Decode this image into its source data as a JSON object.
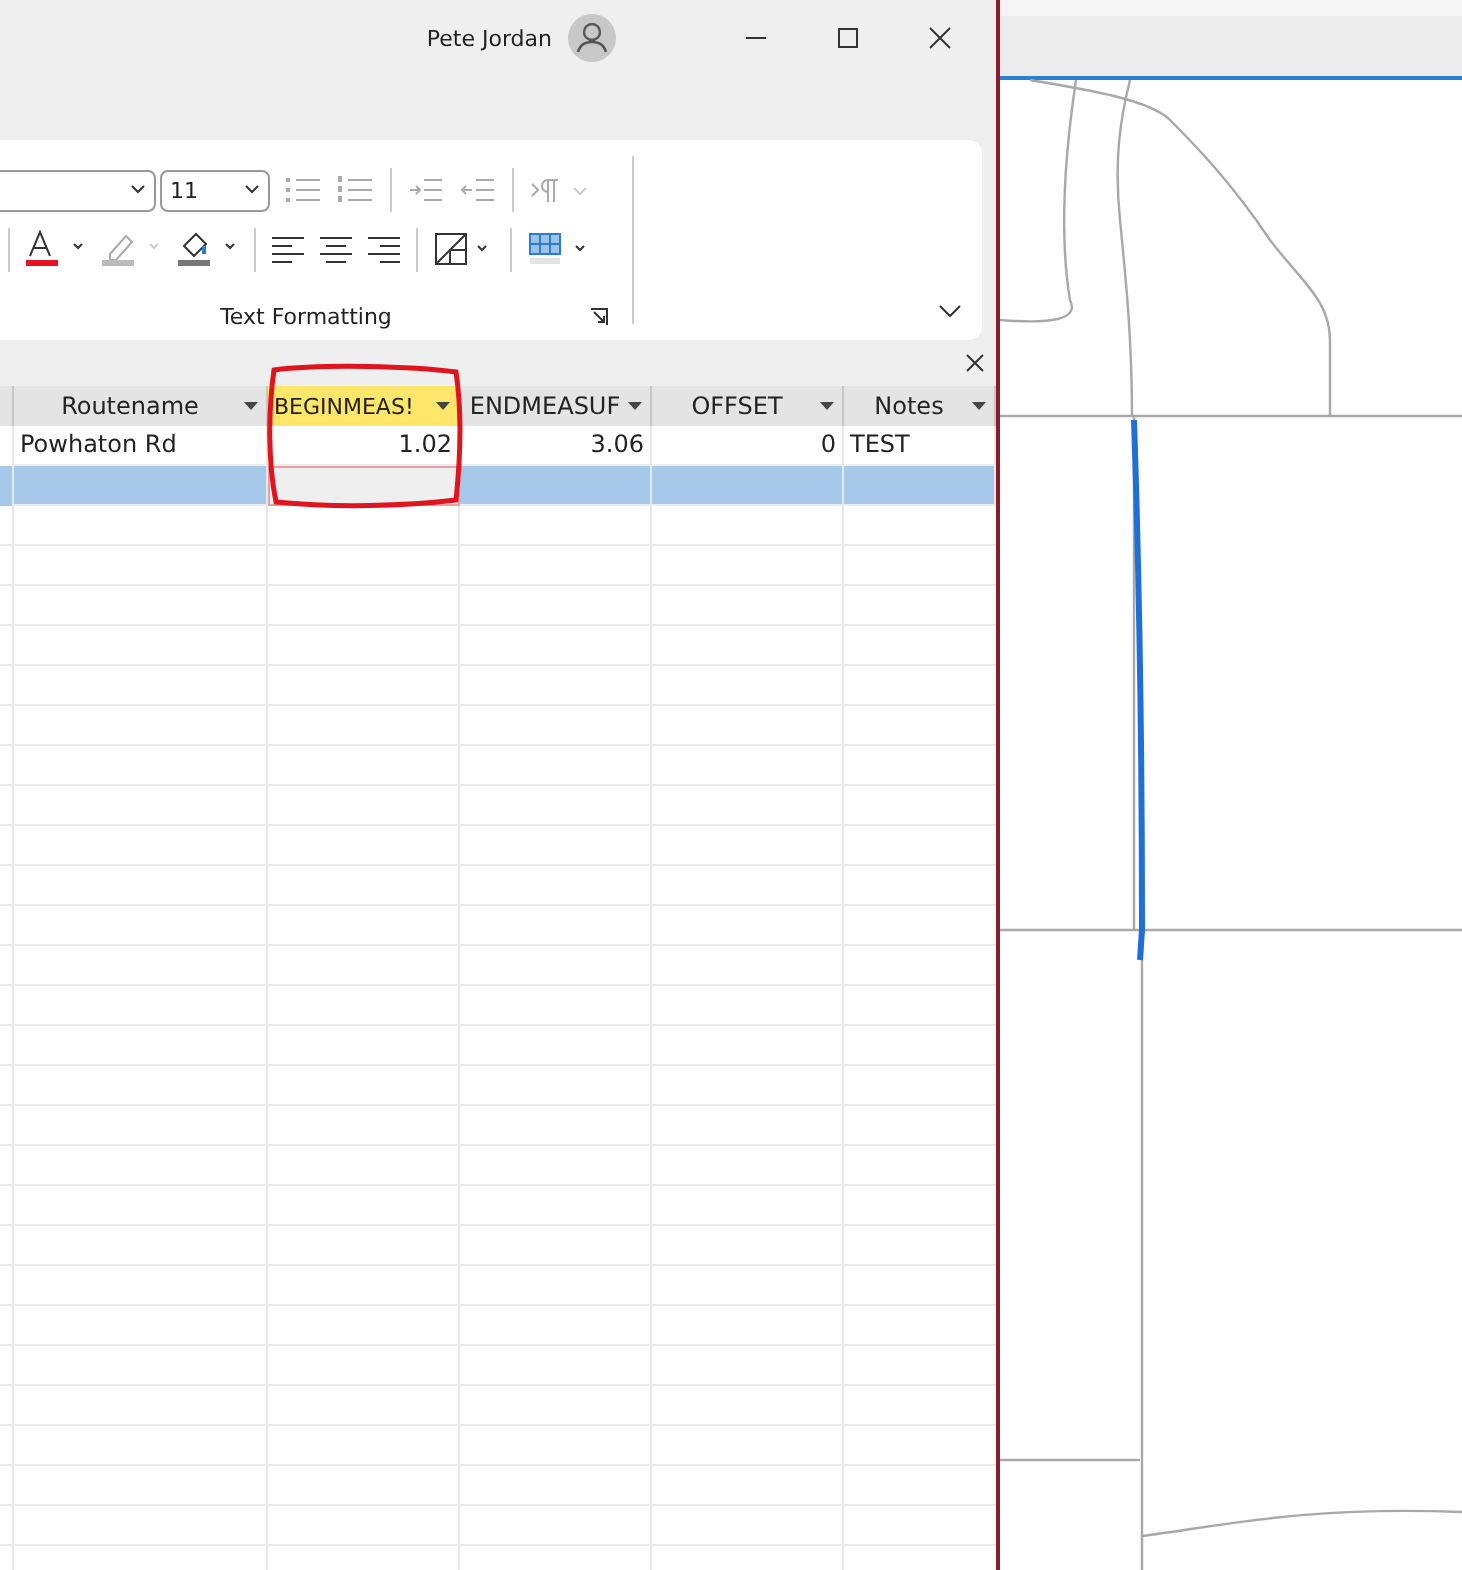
{
  "window": {
    "user_name": "Pete Jordan"
  },
  "ribbon": {
    "font_size": "11",
    "group_label": "Text Formatting"
  },
  "table": {
    "columns": [
      {
        "label": "Routename",
        "selected": false
      },
      {
        "label": "BEGINMEAS!",
        "selected": true
      },
      {
        "label": "ENDMEASUF",
        "selected": false
      },
      {
        "label": "OFFSET",
        "selected": false
      },
      {
        "label": "Notes",
        "selected": false
      }
    ],
    "rows": [
      {
        "selected": false,
        "cells": [
          "Powhaton Rd",
          "1.02",
          "3.06",
          "0",
          "TEST"
        ]
      },
      {
        "selected": true
      }
    ]
  }
}
